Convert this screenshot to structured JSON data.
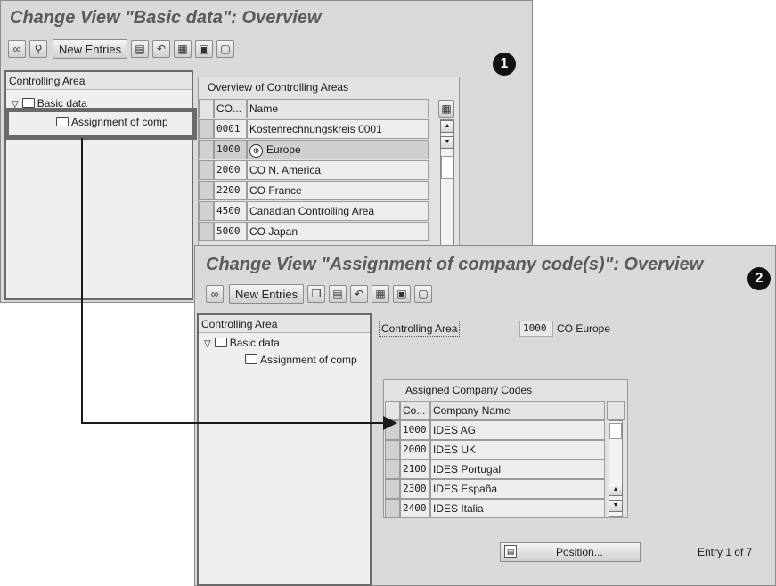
{
  "window1": {
    "title": "Change View \"Basic data\": Overview",
    "new_entries_label": "New Entries",
    "badge": "1",
    "tree": {
      "header": "Controlling Area",
      "node1": "Basic data",
      "node2": "Assignment of comp"
    },
    "table": {
      "title": "Overview of Controlling Areas",
      "headers": [
        "CO...",
        "Name"
      ],
      "rows": [
        {
          "code": "0001",
          "name": "Kostenrechnungskreis 0001"
        },
        {
          "code": "1000",
          "name": "Europe"
        },
        {
          "code": "2000",
          "name": "CO N. America"
        },
        {
          "code": "2200",
          "name": "CO France"
        },
        {
          "code": "4500",
          "name": "Canadian Controlling Area"
        },
        {
          "code": "5000",
          "name": "CO Japan"
        }
      ]
    }
  },
  "window2": {
    "title": "Change View \"Assignment of company code(s)\": Overview",
    "new_entries_label": "New Entries",
    "badge": "2",
    "tree": {
      "header": "Controlling Area",
      "node1": "Basic data",
      "node2": "Assignment of comp"
    },
    "field": {
      "label": "Controlling Area",
      "value": "1000",
      "desc": "CO Europe"
    },
    "table": {
      "title": "Assigned Company Codes",
      "headers": [
        "Co...",
        "Company Name"
      ],
      "rows": [
        {
          "code": "1000",
          "name": "IDES AG"
        },
        {
          "code": "2000",
          "name": "IDES UK"
        },
        {
          "code": "2100",
          "name": "IDES Portugal"
        },
        {
          "code": "2300",
          "name": "IDES España"
        },
        {
          "code": "2400",
          "name": "IDES Italia"
        }
      ]
    },
    "position_label": "Position...",
    "entry_info": "Entry 1 of 7"
  }
}
